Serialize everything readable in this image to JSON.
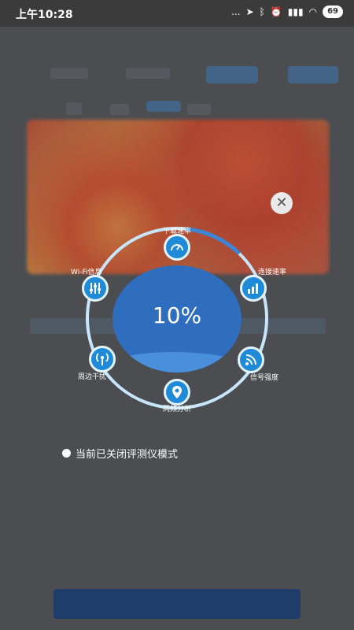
{
  "status_bar": {
    "time": "上午10:28",
    "dots": "...",
    "battery": "69"
  },
  "overlay": {
    "close_icon": "close-icon",
    "progress_value": "10%",
    "progress_fraction": 0.1,
    "nodes": {
      "download": "下载速率",
      "connect": "连接速率",
      "signal": "信号强度",
      "channel": "同频分析",
      "interference": "周边干扰",
      "wifi_info": "Wi-Fi信息"
    },
    "mode_status": "当前已关闭评测仪模式"
  },
  "colors": {
    "accent": "#1f8ad8",
    "disc": "#2f6ebf",
    "ring": "#bfe1fb"
  }
}
